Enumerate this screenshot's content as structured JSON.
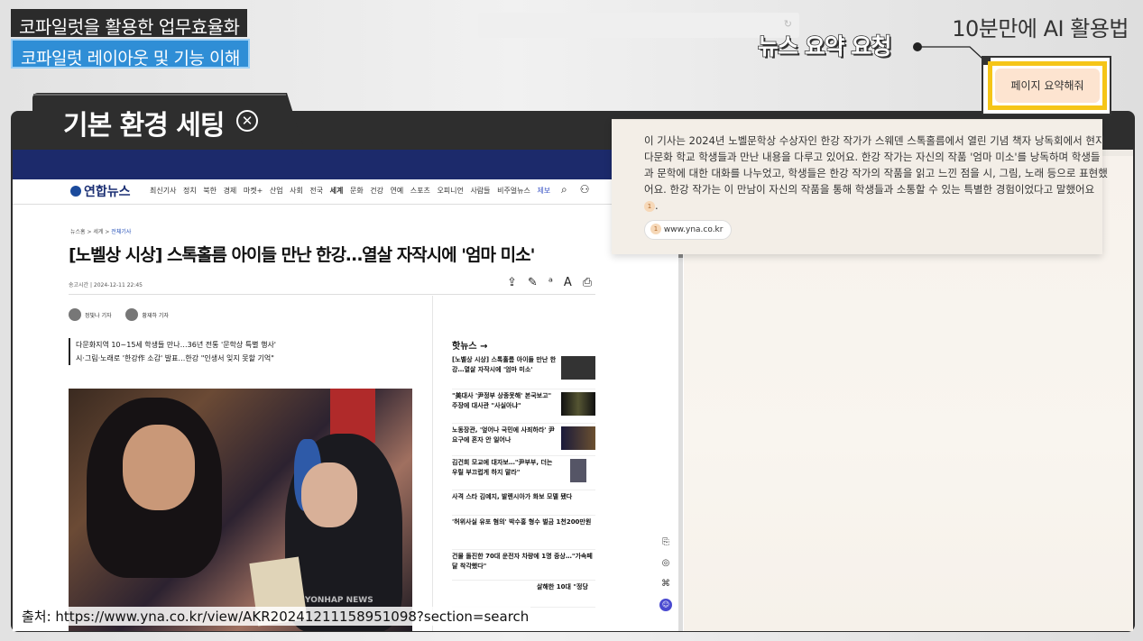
{
  "header": {
    "course_title": "코파일럿을 활용한 업무효율화",
    "course_subtitle": "코파일럿 레이아웃 및 기능 이해",
    "series_title": "10분만에 AI 활용법",
    "refresh_icon": "refresh-icon"
  },
  "section": {
    "tab_title": "기본 환경 세팅",
    "tab_icon": "close-circle-icon"
  },
  "article_page": {
    "logo": "연합뉴스",
    "nav_items": [
      "최신기사",
      "정치",
      "북한",
      "경제",
      "마켓+",
      "산업",
      "사회",
      "전국",
      "세계",
      "문화",
      "건강",
      "연예",
      "스포츠",
      "오피니언",
      "사람들",
      "비주얼뉴스",
      "제보"
    ],
    "breadcrumb": [
      "뉴스홈",
      "세계",
      "전체기사"
    ],
    "headline": "[노벨상 시상] 스톡홀름 아이들 만난 한강…열살 자작시에 '엄마 미소'",
    "dateline": "송고시간 | 2024-12-11 22:45",
    "reporters": [
      "정빛나 기자",
      "황재하 기자"
    ],
    "sub_headlines": [
      "다문화지역 10~15세 학생들 만나…36년 전통 '문학상 특별 행사'",
      "시·그림·노래로 '한강作 소감' 발표…한강 \"인생서 잊지 못할 기억\""
    ],
    "photo_watermark": "YONHAP NEWS",
    "hot_news_title": "핫뉴스",
    "hot_news": [
      "[노벨상 시상] 스톡홀름 아이들 만난 한강…열살 자작시에 '엄마 미소'",
      "\"美대사 '尹정부 상종못해' 본국보고\" 주장에 대사관 \"사실아냐\"",
      "노동장관, '엎어나 국민에 사죄하라' 尹 요구에 혼자 안 일어나",
      "김건희 모교에 대자보…\"尹부부, 더는 우릴 부끄럽게 하지 말라\"",
      "사격 스타 김예지, 발렌시아가 화보 모델 됐다",
      "'허위사실 유포 혐의' 박수홍 형수 벌금 1천200만원",
      "건물 돌진한 70대 운전자 차량에 1명 중상…\"가속페달 착각했다\"",
      "살해한 10대 \"정당"
    ]
  },
  "copilot": {
    "callout_label": "뉴스 요약 요청",
    "request_button": "페이지 요약해줘",
    "summary": "이 기사는 2024년 노벨문학상 수상자인 한강 작가가 스웨덴 스톡홀름에서 열린 기념 책자 낭독회에서 현지 다문화 학교 학생들과 만난 내용을 다루고 있어요. 한강 작가는 자신의 작품 '엄마 미소'를 낭독하며 학생들과 문학에 대한 대화를 나누었고, 학생들은 한강 작가의 작품을 읽고 느낀 점을 시, 그림, 노래 등으로 표현했어요. 한강 작가는 이 만남이 자신의 작품을 통해 학생들과 소통할 수 있는 특별한 경험이었다고 말했어요",
    "citation_number": "1",
    "source_domain": "www.yna.co.kr"
  },
  "footer": {
    "credit": "출처: https://www.yna.co.kr/view/AKR20241211158951098?section=search"
  },
  "colors": {
    "header_dark": "#2b2b2b",
    "subtitle_blue": "#2f8ed6",
    "frame_dark": "#2e2e2e",
    "navy_banner": "#1c2a6b",
    "highlight_yellow": "#f5c518",
    "request_bg": "#fde4d0"
  }
}
